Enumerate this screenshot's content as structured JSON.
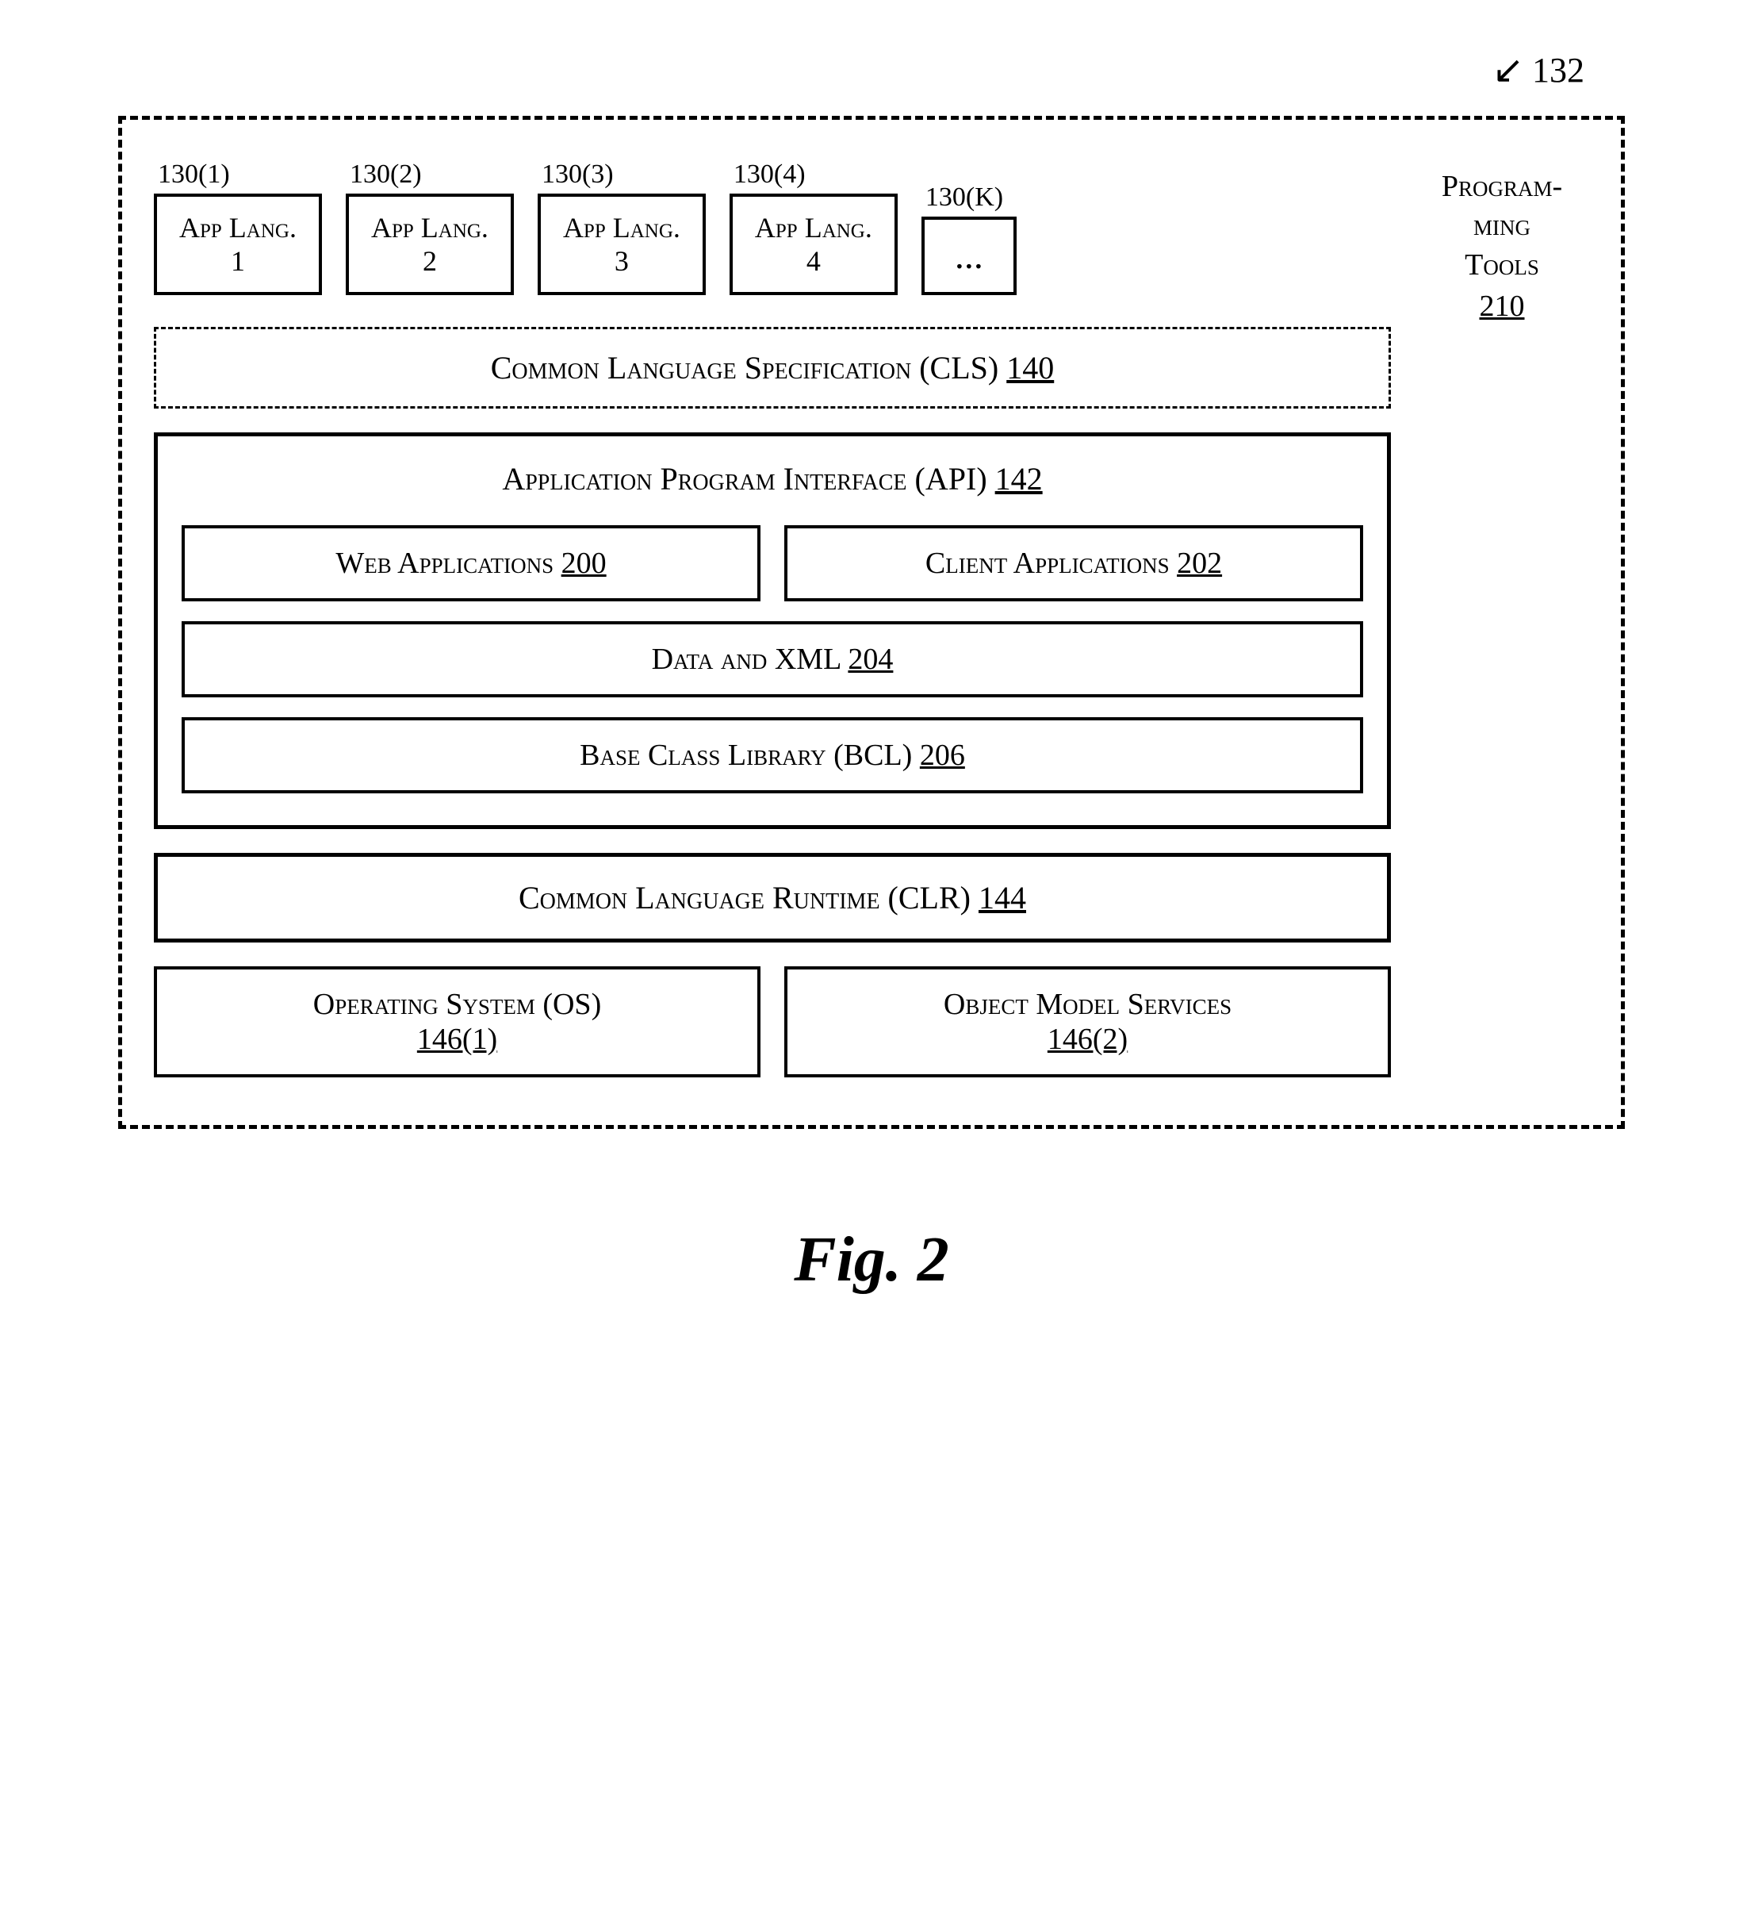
{
  "diagram": {
    "ref_132": "132",
    "outer_ref_arrow": "↙",
    "app_languages": [
      {
        "ref": "130(1)",
        "line1": "App Lang.",
        "line2": "1"
      },
      {
        "ref": "130(2)",
        "line1": "App Lang.",
        "line2": "2"
      },
      {
        "ref": "130(3)",
        "line1": "App Lang.",
        "line2": "3"
      },
      {
        "ref": "130(4)",
        "line1": "App Lang.",
        "line2": "4"
      },
      {
        "ref": "130(K)",
        "ellipsis": "..."
      }
    ],
    "cls": {
      "label": "Common Language Specification (CLS)",
      "ref": "140"
    },
    "api": {
      "label": "Application Program Interface (API)",
      "ref": "142",
      "web_apps": {
        "label": "Web Applications",
        "ref": "200"
      },
      "client_apps": {
        "label": "Client Applications",
        "ref": "202"
      },
      "data_xml": {
        "label": "Data and XML",
        "ref": "204"
      },
      "bcl": {
        "label": "Base Class Library (BCL)",
        "ref": "206"
      }
    },
    "clr": {
      "label": "Common Language Runtime (CLR)",
      "ref": "144"
    },
    "os": {
      "label": "Operating System (OS)",
      "ref": "146(1)"
    },
    "oms": {
      "label": "Object Model Services",
      "ref": "146(2)"
    },
    "prog_tools": {
      "label1": "Program-",
      "label2": "ming",
      "label3": "Tools",
      "ref": "210"
    }
  },
  "figure_caption": "Fig. 2"
}
